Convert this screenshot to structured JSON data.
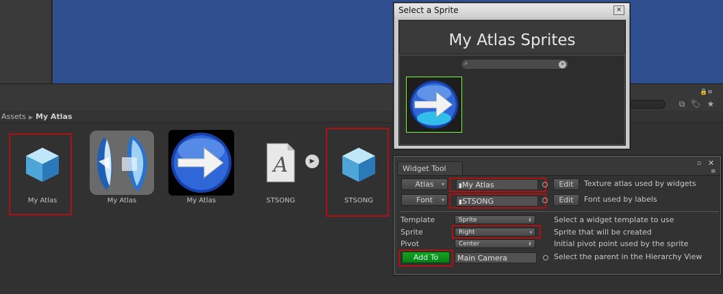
{
  "breadcrumb": {
    "root": "Assets",
    "current": "My Atlas"
  },
  "assets": [
    {
      "label": "My Atlas",
      "kind": "cube",
      "highlighted": true
    },
    {
      "label": "My Atlas",
      "kind": "atlas-texture",
      "highlighted": false
    },
    {
      "label": "My Atlas",
      "kind": "arrow-sprite",
      "highlighted": false
    },
    {
      "label": "STSONG",
      "kind": "font",
      "glyph": "A",
      "highlighted": false
    },
    {
      "label": "STSONG",
      "kind": "cube",
      "highlighted": true
    }
  ],
  "sprite_window": {
    "title": "Select a Sprite",
    "heading": "My Atlas Sprites",
    "search_value": ""
  },
  "widget_tool": {
    "tab": "Widget Tool",
    "atlas": {
      "button": "Atlas",
      "value": "My Atlas",
      "edit": "Edit",
      "desc": "Texture atlas used by widgets"
    },
    "font": {
      "button": "Font",
      "value": "STSONG",
      "edit": "Edit",
      "desc": "Font used by labels"
    },
    "template": {
      "label": "Template",
      "value": "Sprite",
      "desc": "Select a widget template to use"
    },
    "sprite": {
      "label": "Sprite",
      "value": "Right",
      "desc": "Sprite that will be created"
    },
    "pivot": {
      "label": "Pivot",
      "value": "Center",
      "desc": "Initial pivot point used by the sprite"
    },
    "parent": {
      "button": "Add To",
      "value": "Main Camera",
      "desc": "Select the parent in the Hierarchy View"
    }
  },
  "colors": {
    "scene": "#304f90",
    "highlight": "#b01010",
    "add_button": "#0b8a17",
    "selection": "#7cff2a"
  }
}
